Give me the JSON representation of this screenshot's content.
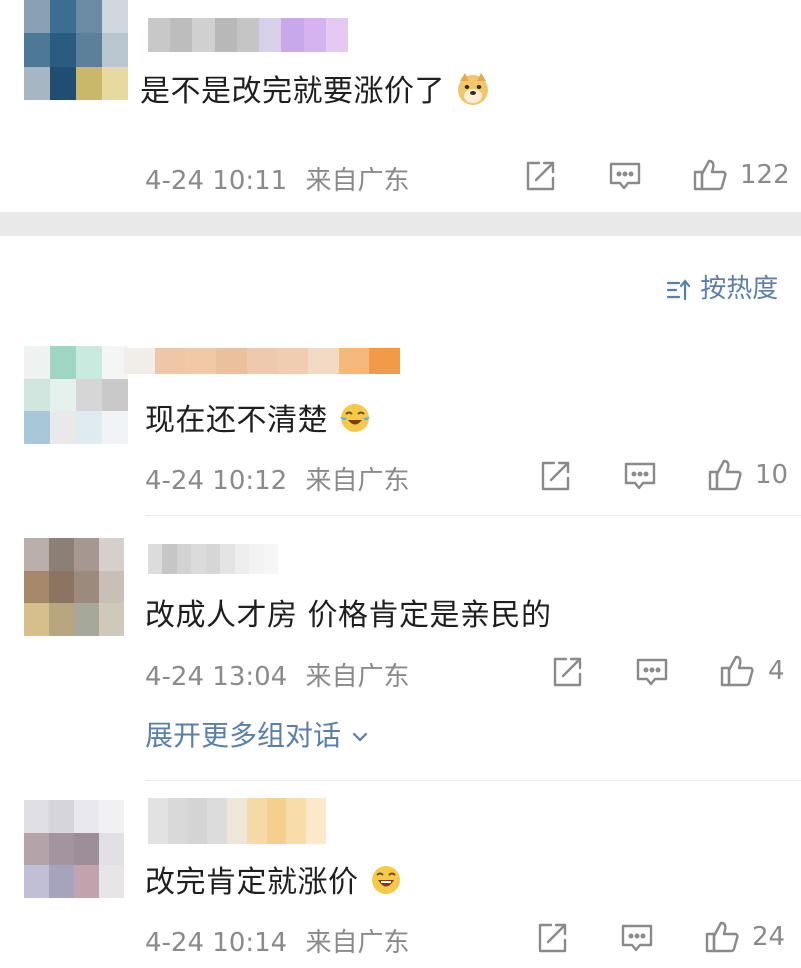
{
  "comments": [
    {
      "text": "是不是改完就要涨价了",
      "emoji": "doge-emoji",
      "time": "4-24 10:11",
      "location": "来自广东",
      "likes": "122",
      "name_colors": [
        "#c8c8c8",
        "#bdbdbd",
        "#d0d0d0",
        "#b8b8b8",
        "#c5c5c5",
        "#d8cfe8",
        "#c7a8ea",
        "#d5b3f0",
        "#e4c9f3"
      ],
      "avatar_colors": [
        "#8aa0b3",
        "#3d6d90",
        "#6b8aa3",
        "#cfd7de",
        "#4d7896",
        "#2c5b82",
        "#5c7f9a",
        "#b9c5cf",
        "#a7b6c3",
        "#1f4e72",
        "#c9b76a",
        "#e8d9a0"
      ]
    },
    {
      "text": "现在还不清楚",
      "emoji": "crying-laugh-emoji",
      "time": "4-24 10:12",
      "location": "来自广东",
      "likes": "10",
      "name_colors": [
        "#f1ede9",
        "#efc7a7",
        "#f0c9a6",
        "#eac19c",
        "#efc9ad",
        "#f0cdb1",
        "#f2d9c3",
        "#f6b77b",
        "#f29a48"
      ],
      "avatar_colors": [
        "#eef2f0",
        "#9ed6c3",
        "#c9eadf",
        "#f3f6f5",
        "#cfe6df",
        "#e4f1ec",
        "#d6d6d6",
        "#c9c9c9",
        "#a8c8d9",
        "#e9e9e9",
        "#dfeaf1",
        "#f0f4f7"
      ]
    },
    {
      "text": "改成人才房 价格肯定是亲民的",
      "emoji": "",
      "time": "4-24 13:04",
      "location": "来自广东",
      "likes": "4",
      "name_colors": [
        "#dcdcdc",
        "#c6c6c6",
        "#d2d2d2",
        "#dbdbdb",
        "#d6d6d6",
        "#e4e4e4",
        "#eeeeee",
        "#f3f3f3",
        "#f6f6f6"
      ],
      "avatar_colors": [
        "#b9aea9",
        "#8c7f76",
        "#a69890",
        "#d6cfcb",
        "#a6876a",
        "#8b7462",
        "#9c8b7c",
        "#c9bfb6",
        "#d7bf8c",
        "#b7a67f",
        "#a6a899",
        "#cfc9bb"
      ]
    },
    {
      "text": "改完肯定就涨价",
      "emoji": "laughing-emoji",
      "time": "4-24 10:14",
      "location": "来自广东",
      "likes": "24",
      "name_colors": [
        "#e2e2e2",
        "#d9d9d9",
        "#d4d4d4",
        "#dcdcdc",
        "#eee7d8",
        "#f5d9a6",
        "#f6cf8e",
        "#f8dca9",
        "#fbe9c9"
      ],
      "avatar_colors": [
        "#e1dfe6",
        "#d6d4dd",
        "#e9e8ee",
        "#f1f0f4",
        "#b4a3a8",
        "#a494a1",
        "#9e8e99",
        "#e3dfe6",
        "#c0bfd5",
        "#a6a3bd",
        "#c2a2ad",
        "#e7e4ea"
      ]
    }
  ],
  "sort": {
    "label": "按热度",
    "icon": "sort-icon"
  },
  "expand_thread": {
    "label": "展开更多组对话"
  },
  "icons": {
    "share": "share-icon",
    "comment": "comment-icon",
    "like": "thumbs-up-icon"
  },
  "colors": {
    "link": "#5a7fa8",
    "meta": "#8a8a8a",
    "text": "#1f1f1f",
    "divider": "#e9e9e9"
  }
}
